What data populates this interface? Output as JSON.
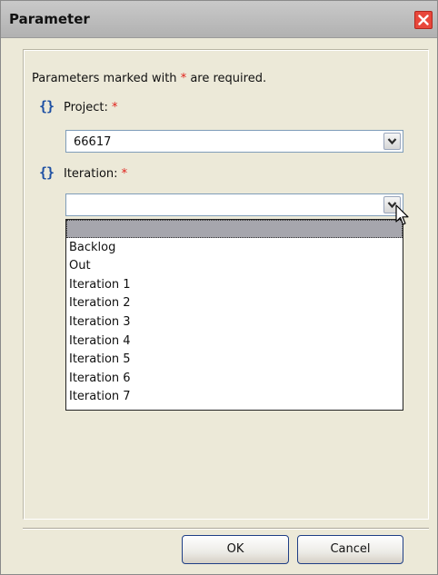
{
  "window": {
    "title": "Parameter",
    "close_label": "Close"
  },
  "form": {
    "note_prefix": "Parameters marked with ",
    "note_star": "*",
    "note_suffix": " are required.",
    "project": {
      "label": "Project:",
      "required_star": "*",
      "icon": "curly-braces-icon",
      "value": "66617"
    },
    "iteration": {
      "label": "Iteration:",
      "required_star": "*",
      "icon": "curly-braces-icon",
      "value": "",
      "dropdown_open": true,
      "options": [
        "",
        "Backlog",
        "Out",
        "Iteration 1",
        "Iteration 2",
        "Iteration 3",
        "Iteration 4",
        "Iteration 5",
        "Iteration 6",
        "Iteration 7"
      ],
      "highlighted_option": 0
    }
  },
  "buttons": {
    "ok": "OK",
    "cancel": "Cancel"
  },
  "colors": {
    "dialog_bg": "#ece9d8",
    "required": "#e0201a",
    "close_red": "#e8473b",
    "button_border": "#1f3f86",
    "selected_option": "#a6a6ad",
    "brace_blue": "#1d4fa3"
  }
}
